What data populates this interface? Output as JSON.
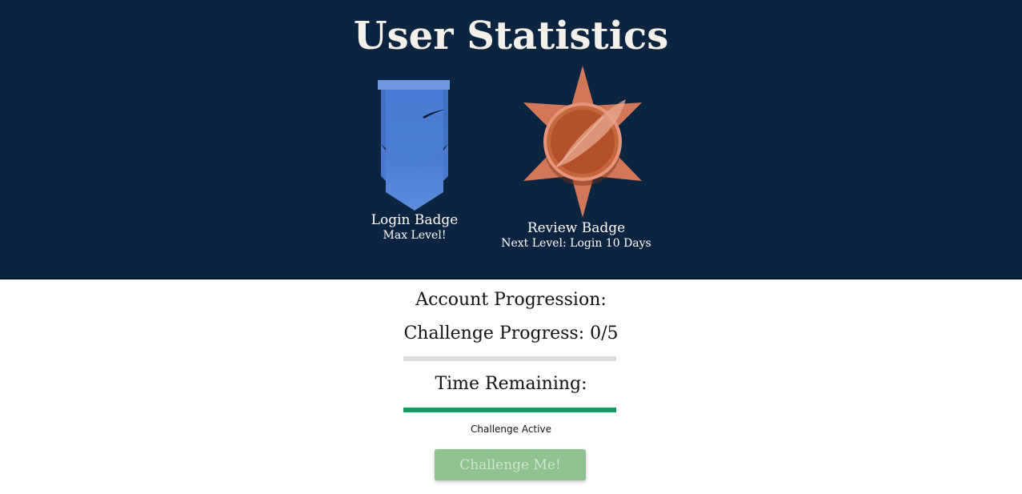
{
  "header": {
    "title": "User Statistics"
  },
  "badges": [
    {
      "name": "Login Badge",
      "status": "Max Level!",
      "icon": "banner-icon",
      "color": "#4f7fd6"
    },
    {
      "name": "Review Badge",
      "status": "Next Level: Login 10 Days",
      "icon": "quill-star-icon",
      "color": "#d9765a"
    }
  ],
  "progression": {
    "heading": "Account Progression:",
    "challenge_progress_label": "Challenge Progress: 0/5",
    "challenge_progress_fraction": 0,
    "time_remaining_label": "Time Remaining:",
    "time_remaining_fraction": 1,
    "status": "Challenge Active",
    "button_label": "Challenge Me!"
  },
  "colors": {
    "header_bg": "#0b2541",
    "progress_track": "#dddddd",
    "time_bar": "#169b62",
    "button_bg": "#8fc191"
  }
}
